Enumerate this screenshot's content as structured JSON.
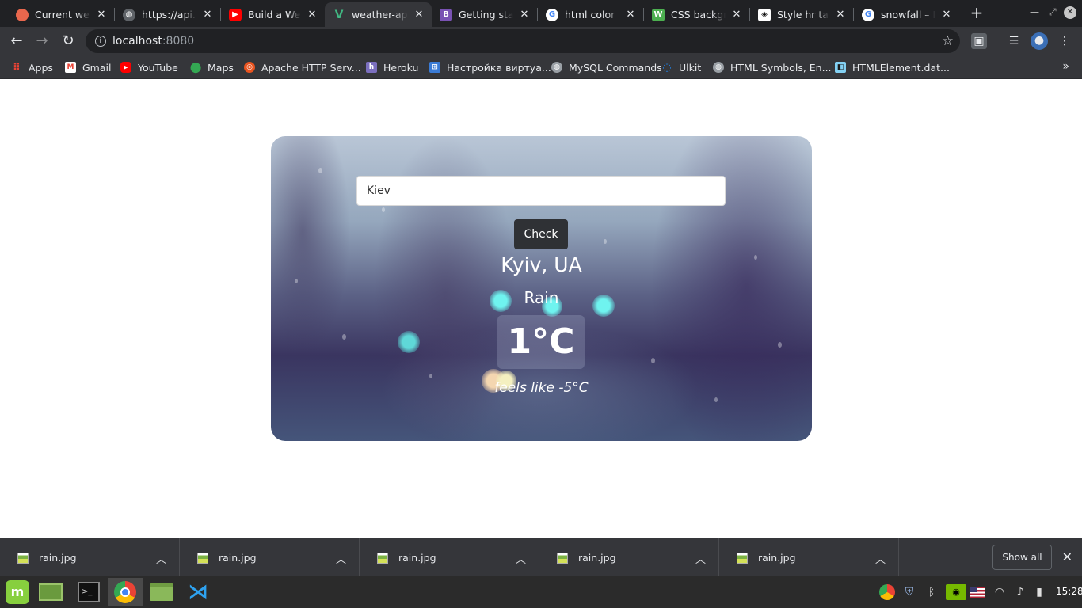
{
  "tabs": [
    {
      "title": "Current weather",
      "icon": "weather-favicon-icon",
      "color": "#e8674d"
    },
    {
      "title": "https://api.openweathermap.org",
      "icon": "globe-icon",
      "color": "#5f6368"
    },
    {
      "title": "Build a Weather App",
      "icon": "youtube-icon",
      "color": "#ff0000"
    },
    {
      "title": "weather-app",
      "icon": "vue-icon",
      "color": "#41b883"
    },
    {
      "title": "Getting started",
      "icon": "bootstrap-vue-icon",
      "color": "#7952b3"
    },
    {
      "title": "html color picker",
      "icon": "google-icon",
      "color": "#4285f4"
    },
    {
      "title": "CSS background",
      "icon": "w3schools-icon",
      "color": "#4caf50"
    },
    {
      "title": "Style hr tag",
      "icon": "codepen-icon",
      "color": "#ffffff"
    },
    {
      "title": "snowfall – Пошук Google",
      "icon": "google-icon",
      "color": "#4285f4"
    }
  ],
  "toolbar": {
    "host": "localhost",
    "port": ":8080"
  },
  "bookmarks": [
    {
      "label": "Apps",
      "icon": "apps-grid-icon",
      "color": "#e8eaed"
    },
    {
      "label": "Gmail",
      "icon": "gmail-icon",
      "color": "#ea4335"
    },
    {
      "label": "YouTube",
      "icon": "youtube-icon",
      "color": "#ff0000"
    },
    {
      "label": "Maps",
      "icon": "maps-pin-icon",
      "color": "#34a853"
    },
    {
      "label": "Apache HTTP Serv...",
      "icon": "ubuntu-icon",
      "color": "#e95420"
    },
    {
      "label": "Heroku",
      "icon": "heroku-icon",
      "color": "#7b6fbf"
    },
    {
      "label": "Настройка виртуа...",
      "icon": "bookmark-icon",
      "color": "#3a7bd5"
    },
    {
      "label": "MySQL Commands",
      "icon": "globe-icon",
      "color": "#9aa0a6"
    },
    {
      "label": "Ulkit",
      "icon": "uikit-icon",
      "color": "#1e87f0"
    },
    {
      "label": "HTML Symbols, En...",
      "icon": "globe-icon",
      "color": "#9aa0a6"
    },
    {
      "label": "HTMLElement.dat...",
      "icon": "mdn-icon",
      "color": "#83d0f2"
    }
  ],
  "weather": {
    "search_value": "Kiev",
    "check_label": "Check",
    "location": "Kyiv, UA",
    "condition": "Rain",
    "temperature": "1°C",
    "feels_like": "feels like -5°C"
  },
  "downloads": {
    "items": [
      "rain.jpg",
      "rain.jpg",
      "rain.jpg",
      "rain.jpg",
      "rain.jpg"
    ],
    "show_all": "Show all"
  },
  "taskbar": {
    "clock": "15:28"
  }
}
